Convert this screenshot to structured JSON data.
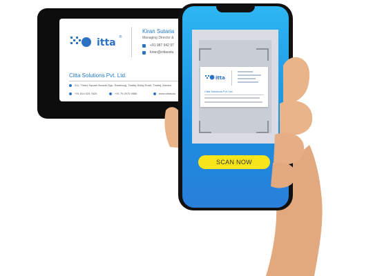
{
  "business_card": {
    "name": "Kiran Sutaria",
    "role": "Managing Director &",
    "phone": "+91 987 942 97",
    "email": "kiran@cittasolu",
    "company": "Citta Solutions Pvt. Ltd.",
    "address": "911, Times Square Arcade,Opp. Rambaug, Thaltej-Shilaj Road, Thaltej, Ahmed",
    "landline": "+91 814 024 7620",
    "mobile": "+91 79 2970 9586",
    "website": "www.cittasolu"
  },
  "logo": {
    "text": "citta",
    "icon": "citta-logo-icon",
    "registered": "®"
  },
  "preview_card": {
    "company": "Citta Solutions Pvt. Ltd."
  },
  "scan_button": {
    "label": "SCAN NOW"
  },
  "colors": {
    "brand_blue": "#1f78c9",
    "screen_top": "#2eb6f3",
    "screen_bottom": "#2a7fdb",
    "button": "#f7e51c",
    "skin": "#e9b48a"
  }
}
